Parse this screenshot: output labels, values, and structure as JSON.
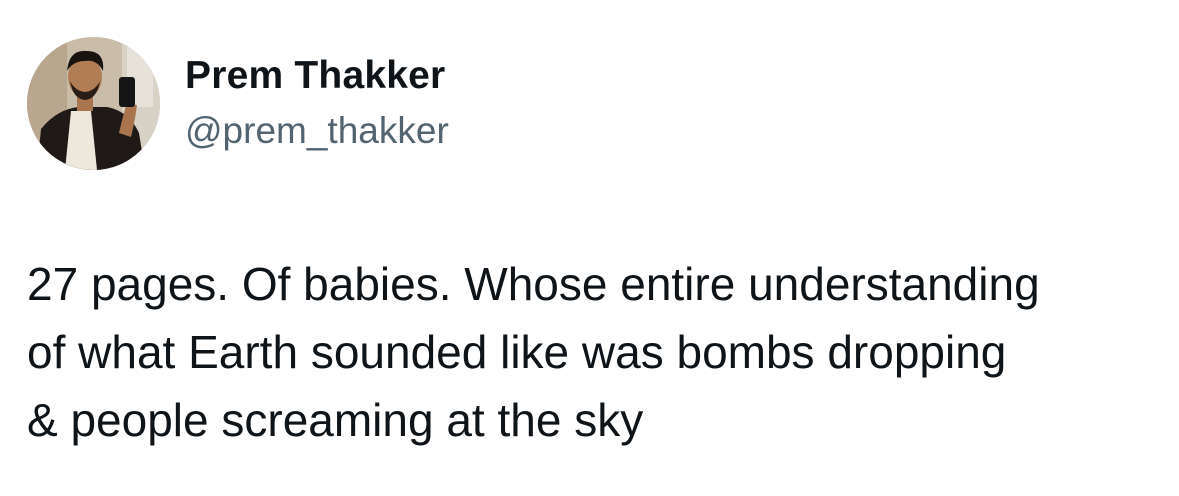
{
  "author": {
    "display_name": "Prem Thakker",
    "handle": "@prem_thakker",
    "avatar_icon": "profile-photo"
  },
  "tweet": {
    "lines": [
      "27 pages. Of babies. Whose entire understanding",
      "of what Earth sounded like was bombs dropping",
      "& people screaming at the sky"
    ]
  },
  "colors": {
    "text_primary": "#0f1419",
    "text_secondary": "#536471",
    "background": "#ffffff"
  }
}
